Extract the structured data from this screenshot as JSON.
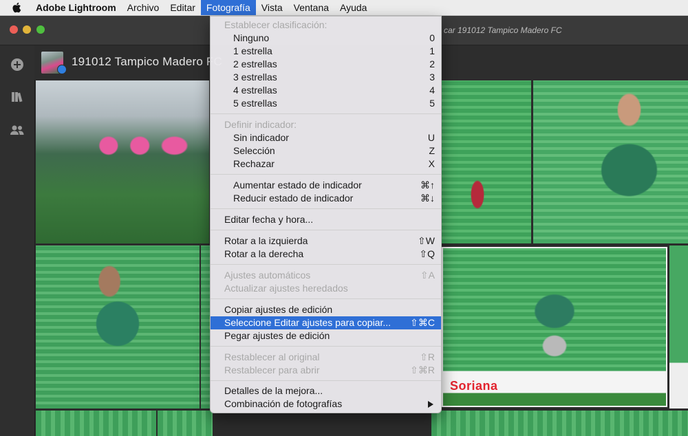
{
  "menubar": {
    "app_name": "Adobe Lightroom",
    "items": [
      "Archivo",
      "Editar",
      "Fotografía",
      "Vista",
      "Ventana",
      "Ayuda"
    ],
    "active_item": "Fotografía"
  },
  "window": {
    "title": "car 191012 Tampico Madero FC"
  },
  "album": {
    "title": "191012 Tampico Madero FC"
  },
  "photo_ad_text": "Soriana",
  "dropdown": {
    "rating_header": "Establecer clasificación:",
    "ratings": [
      {
        "label": "Ninguno",
        "shortcut": "0"
      },
      {
        "label": "1 estrella",
        "shortcut": "1"
      },
      {
        "label": "2 estrellas",
        "shortcut": "2"
      },
      {
        "label": "3 estrellas",
        "shortcut": "3"
      },
      {
        "label": "4 estrellas",
        "shortcut": "4"
      },
      {
        "label": "5 estrellas",
        "shortcut": "5"
      }
    ],
    "flag_header": "Definir indicador:",
    "flags": [
      {
        "label": "Sin indicador",
        "shortcut": "U"
      },
      {
        "label": "Selección",
        "shortcut": "Z"
      },
      {
        "label": "Rechazar",
        "shortcut": "X"
      }
    ],
    "flag_state": [
      {
        "label": "Aumentar estado de indicador",
        "shortcut": "⌘↑"
      },
      {
        "label": "Reducir estado de indicador",
        "shortcut": "⌘↓"
      }
    ],
    "edit_date": {
      "label": "Editar fecha y hora..."
    },
    "rotate": [
      {
        "label": "Rotar a la izquierda",
        "shortcut": "⇧W"
      },
      {
        "label": "Rotar a la derecha",
        "shortcut": "⇧Q"
      }
    ],
    "auto": [
      {
        "label": "Ajustes automáticos",
        "shortcut": "⇧A"
      },
      {
        "label": "Actualizar ajustes heredados",
        "shortcut": ""
      }
    ],
    "copy_paste": [
      {
        "label": "Copiar ajustes de edición",
        "shortcut": ""
      },
      {
        "label": "Seleccione Editar ajustes para copiar...",
        "shortcut": "⇧⌘C"
      },
      {
        "label": "Pegar ajustes de edición",
        "shortcut": ""
      }
    ],
    "reset": [
      {
        "label": "Restablecer al original",
        "shortcut": "⇧R"
      },
      {
        "label": "Restablecer para abrir",
        "shortcut": "⇧⌘R"
      }
    ],
    "details": {
      "label": "Detalles de la mejora..."
    },
    "merge": {
      "label": "Combinación de fotografías"
    }
  },
  "colors": {
    "highlight": "#2f6fd6",
    "menu_bg": "#eae8ec",
    "window_bg": "#2b2b2b"
  }
}
